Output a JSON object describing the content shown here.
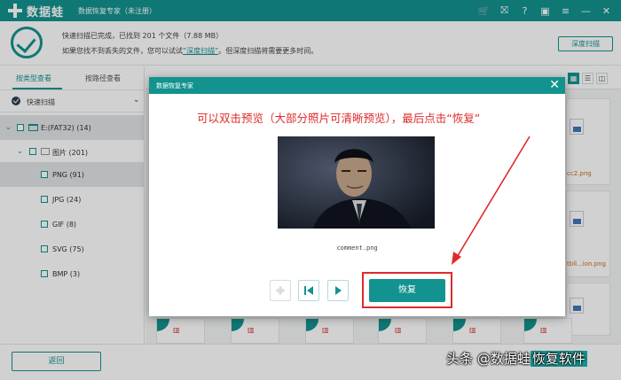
{
  "app": {
    "name": "数据蛙",
    "subtitle": "数据恢复专家（未注册）",
    "icons": [
      "cart-icon",
      "gift-icon",
      "help-icon",
      "save-icon",
      "menu-icon",
      "minimize-icon",
      "close-icon"
    ]
  },
  "status": {
    "line1": "快速扫描已完成，已找到 201 个文件（7.88 MB）",
    "line2_prefix": "如果您找不到丢失的文件，您可以试试",
    "line2_link": "“深度扫描”",
    "line2_suffix": "。但深度扫描将需要更多时间。",
    "deep_scan_button": "深度扫描"
  },
  "sidebar": {
    "tabs": [
      "按类型查看",
      "按路径查看"
    ],
    "scan_mode": "快速扫描",
    "tree": [
      {
        "label": "E:(FAT32) (14)"
      },
      {
        "label": "图片 (201)"
      },
      {
        "label": "PNG (91)"
      },
      {
        "label": "JPG (24)"
      },
      {
        "label": "GIF (8)"
      },
      {
        "label": "SVG (75)"
      },
      {
        "label": "BMP (3)"
      }
    ]
  },
  "background_files": [
    "cc2.png",
    "tbll...ion.png"
  ],
  "bottom": {
    "back_button": "返回"
  },
  "modal": {
    "title": "数据恢复专家",
    "annotation": "可以双击预览（大部分照片可清晰预览），最后点击“恢复”",
    "file_name": "comment.png",
    "recover_button": "恢复"
  },
  "watermark": {
    "prefix": "头条 @数据蛙",
    "highlight": "恢复软件"
  },
  "colors": {
    "accent": "#13938f",
    "annotation_red": "#e02a2a"
  }
}
